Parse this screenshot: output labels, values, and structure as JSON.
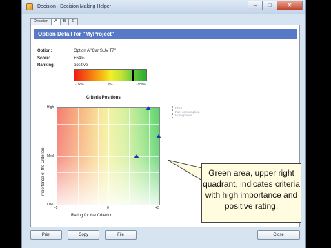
{
  "window": {
    "title": "Decision - Decision Making Helper",
    "buttons": {
      "minimize": "–",
      "maximize": "□",
      "close": "✕"
    }
  },
  "tabs": [
    "Decision",
    "A",
    "B",
    "C"
  ],
  "header": {
    "title": "Option Detail for  \"MyProject\""
  },
  "info": {
    "option_label": "Option:",
    "option_value": "Option A \"Car SUV T7\"",
    "score_label": "Score:",
    "score_value": "+64%",
    "ranking_label": "Ranking:",
    "ranking_value": "positive",
    "ranking_scale": {
      "min": "-100%",
      "mid": "0%",
      "max": "+100%"
    },
    "ranking_level": 0.82
  },
  "chart_data": {
    "type": "scatter",
    "title": "Criteria Positions",
    "xlabel": "Rating for the Criterion",
    "ylabel": "Importance of the Criterion",
    "x_ticks": [
      "-5",
      "0",
      "+5"
    ],
    "y_ticks": [
      "High",
      "Med",
      "Low"
    ],
    "xlim": [
      -5,
      5
    ],
    "legend": [
      "Price",
      "Fuel consumption",
      "Horsepower"
    ],
    "points": [
      {
        "name": "Price",
        "x": 3.9,
        "y": 1.0
      },
      {
        "name": "Fuel consumption",
        "x": 4.9,
        "y": 0.71
      },
      {
        "name": "Horsepower",
        "x": 2.8,
        "y": 0.5
      }
    ]
  },
  "callout": {
    "text": "Green area, upper right quadrant, indicates criteria with high importance and positive rating."
  },
  "footer_buttons": {
    "print": "Print",
    "copy": "Copy",
    "file": "File",
    "close": "Close"
  }
}
